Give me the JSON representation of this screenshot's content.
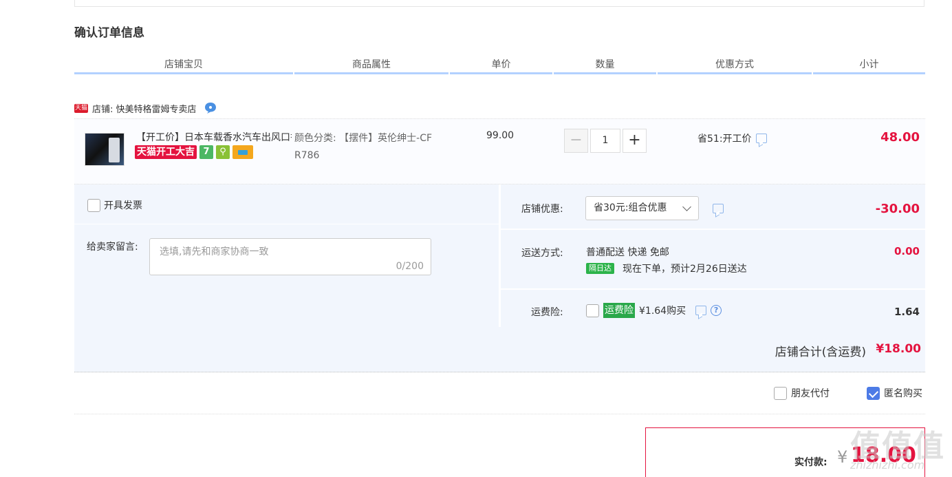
{
  "page_title": "确认订单信息",
  "headers": [
    "店铺宝贝",
    "商品属性",
    "单价",
    "数量",
    "优惠方式",
    "小计"
  ],
  "shop": {
    "logo_text": "天猫",
    "label": "店铺: 快美特格雷姆专卖店"
  },
  "item": {
    "title": "【开工价】日本车载香水汽车出风口香薰",
    "badge": "天猫开工大吉",
    "badge_icon_1": "7",
    "attr_line1": "颜色分类: 【摆件】英伦绅士-CF",
    "attr_line2": "R786",
    "unit_price": "99.00",
    "minus": "−",
    "quantity": "1",
    "plus": "+",
    "promo": "省51:开工价",
    "subtotal": "48.00"
  },
  "invoice_label": "开具发票",
  "message": {
    "label": "给卖家留言:",
    "placeholder": "选填,请先和商家协商一致",
    "count": "0/200"
  },
  "shop_discount": {
    "label": "店铺优惠:",
    "selected": "省30元:组合优惠",
    "amount": "-30.00"
  },
  "shipping": {
    "label": "运送方式:",
    "line1": "普通配送 快递 免邮",
    "badge": "隔日达",
    "line2": "现在下单，预计2月26日送达",
    "amount": "0.00"
  },
  "insurance": {
    "label": "运费险:",
    "badge": "运费险",
    "price": "¥1.64购买",
    "help": "?",
    "amount": "1.64"
  },
  "shop_total": {
    "label": "店铺合计(含运费)",
    "amount": "¥18.00"
  },
  "options": {
    "friend_pay": "朋友代付",
    "anonymous": "匿名购买"
  },
  "payment": {
    "label": "实付款:",
    "yen": "¥",
    "amount": "18.00"
  },
  "watermark": {
    "main": "值值值",
    "sub": "zhizhizhi.com"
  },
  "colors": {
    "price_red": "#e4133f",
    "header_underline": "#b2d1ff",
    "panel_bg": "#f2f6fd",
    "check_blue": "#4d7be6"
  }
}
